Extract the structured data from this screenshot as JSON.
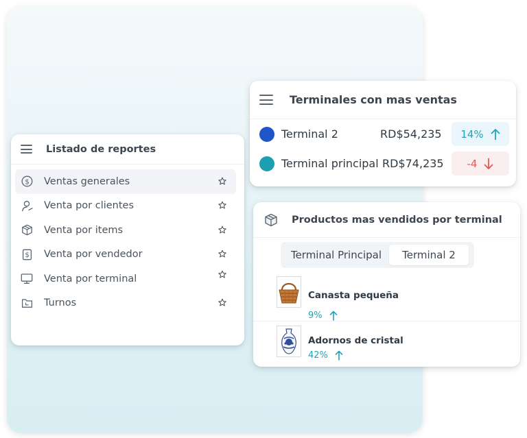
{
  "reports": {
    "title": "Listado de reportes",
    "items": [
      {
        "label": "Ventas generales",
        "icon": "dollar-circle-icon",
        "active": true
      },
      {
        "label": "Venta por clientes",
        "icon": "user-icon",
        "active": false
      },
      {
        "label": "Venta por items",
        "icon": "box-icon",
        "active": false
      },
      {
        "label": "Venta por vendedor",
        "icon": "dollar-receipt-icon",
        "active": false
      },
      {
        "label": "Venta por terminal",
        "icon": "monitor-icon",
        "active": false
      },
      {
        "label": "Turnos",
        "icon": "folder-icon",
        "active": false
      }
    ]
  },
  "terminals": {
    "title": "Terminales con mas ventas",
    "rows": [
      {
        "name": "Terminal 2",
        "amount": "RD$54,235",
        "change": "14%",
        "trend": "up",
        "dot_color": "#1e55c9"
      },
      {
        "name": "Terminal principal",
        "amount": "RD$74,235",
        "change": "-4",
        "trend": "down",
        "dot_color": "#1c9fb0"
      }
    ]
  },
  "products": {
    "title": "Productos mas vendidos por terminal",
    "tabs": [
      {
        "label": "Terminal Principal",
        "selected": false
      },
      {
        "label": "Terminal 2",
        "selected": true
      }
    ],
    "items": [
      {
        "name": "Canasta pequeña",
        "change": "9%",
        "trend": "up",
        "icon": "basket-icon"
      },
      {
        "name": "Adornos de cristal",
        "change": "42%",
        "trend": "up",
        "icon": "vase-icon"
      }
    ]
  },
  "colors": {
    "accent_up": "#20a4b8",
    "accent_down": "#e35757"
  }
}
